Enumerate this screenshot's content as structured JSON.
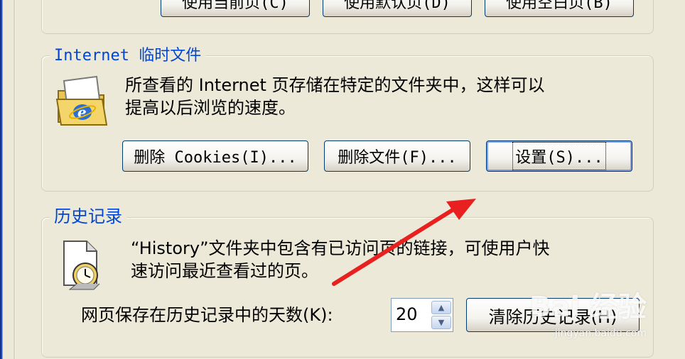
{
  "homepage": {
    "btn_current": "使用当前页(C)",
    "btn_default": "使用默认页(D)",
    "btn_blank": "使用空白页(B)"
  },
  "temp_files": {
    "title": "Internet 临时文件",
    "desc_line1": "所查看的 Internet 页存储在特定的文件夹中，这样可以",
    "desc_line2": "提高以后浏览的速度。",
    "btn_delete_cookies": "删除 Cookies(I)...",
    "btn_delete_files": "删除文件(F)...",
    "btn_settings": "设置(S)..."
  },
  "history": {
    "title": "历史记录",
    "desc_line1": "“History”文件夹中包含有已访问页的链接，可使用户快",
    "desc_line2": "速访问最近查看过的页。",
    "days_label": "网页保存在历史记录中的天数(K):",
    "days_value": "20",
    "btn_clear": "清除历史记录(H)"
  },
  "annotation": {
    "arrow_color": "#e8201f"
  },
  "watermark": {
    "text": "Bai 经验",
    "sub": "jingyan.baidu.com"
  }
}
